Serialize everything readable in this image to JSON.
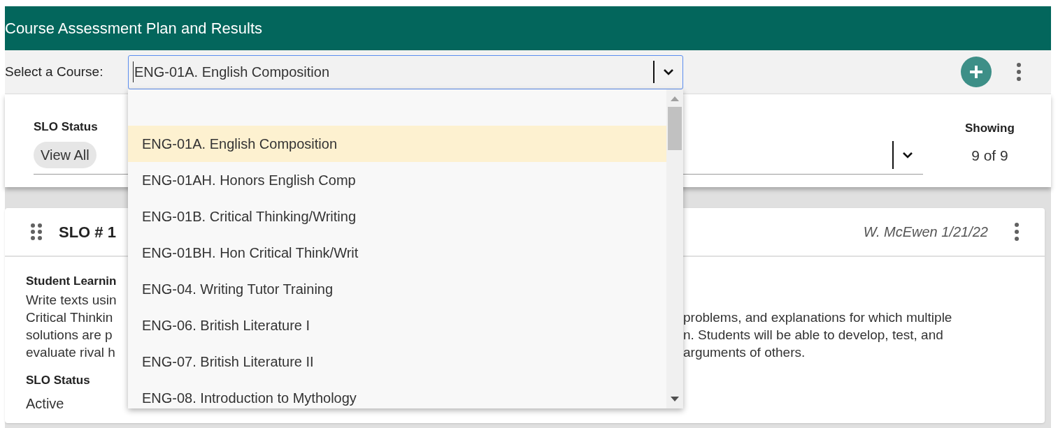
{
  "header": {
    "title": "Course Assessment Plan and Results"
  },
  "toolbar": {
    "label": "Select a Course:",
    "course_field": {
      "value": "ENG-01A. English Composition",
      "expanded": true
    }
  },
  "filters": {
    "slo_status": {
      "label": "SLO Status",
      "chip": "View All"
    },
    "showing": {
      "label": "Showing",
      "value": "9 of 9"
    }
  },
  "slo_card": {
    "title": "SLO # 1",
    "author_date": "W. McEwen 1/21/22",
    "outcome_label": "Student Learnin",
    "outcome_lines": [
      {
        "left": "Write texts usin"
      },
      {
        "left": "Critical Thinkin",
        "right": "problems, and explanations for which multiple"
      },
      {
        "left": "solutions are p",
        "right": "n. Students will be able to develop, test, and"
      },
      {
        "left": "evaluate rival h",
        "right": "arguments of others."
      }
    ],
    "status_label": "SLO Status",
    "status_value": "Active"
  },
  "course_dropdown": {
    "options": [
      {
        "label": "ENG-01A. English Composition",
        "selected": true
      },
      {
        "label": "ENG-01AH. Honors English Comp",
        "selected": false
      },
      {
        "label": "ENG-01B. Critical Thinking/Writing",
        "selected": false
      },
      {
        "label": "ENG-01BH. Hon Critical Think/Writ",
        "selected": false
      },
      {
        "label": "ENG-04. Writing Tutor Training",
        "selected": false
      },
      {
        "label": "ENG-06. British Literature I",
        "selected": false
      },
      {
        "label": "ENG-07. British Literature II",
        "selected": false
      },
      {
        "label": "ENG-08. Introduction to Mythology",
        "selected": false
      }
    ]
  }
}
